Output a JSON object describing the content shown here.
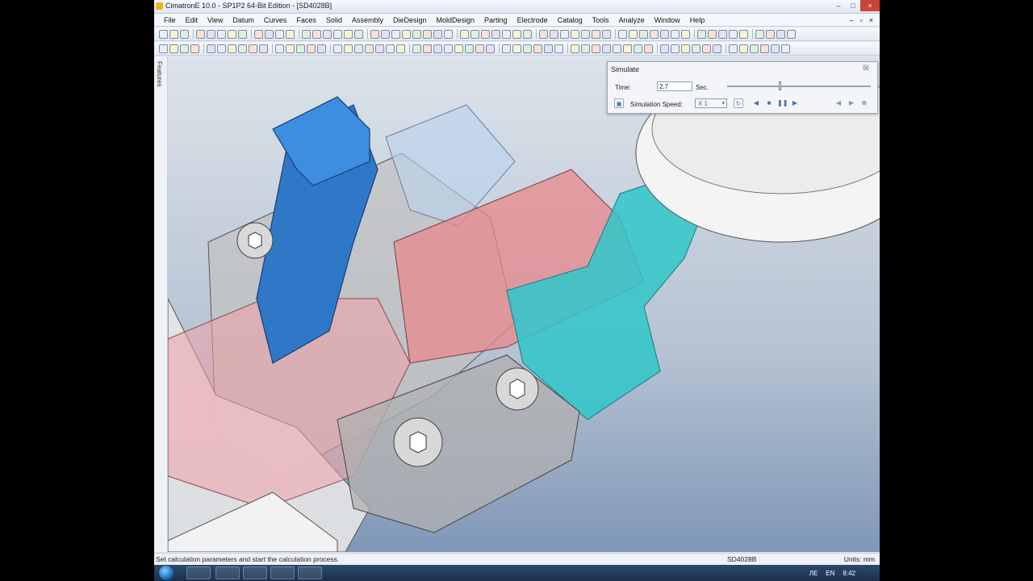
{
  "window": {
    "title": "CimatronE 10.0 - SP1P2 64-Bit Edition - [SD4028B]",
    "controls": [
      "–",
      "□",
      "×"
    ]
  },
  "menubar": {
    "items": [
      "File",
      "Edit",
      "View",
      "Datum",
      "Curves",
      "Faces",
      "Solid",
      "Assembly",
      "DieDesign",
      "MoldDesign",
      "Parting",
      "Electrode",
      "Catalog",
      "Tools",
      "Analyze",
      "Window",
      "Help"
    ],
    "doc_controls": [
      "–",
      "▫",
      "×"
    ]
  },
  "side_panel": {
    "label": "Features"
  },
  "simulate_dialog": {
    "title": "Simulate",
    "time_label": "Time:",
    "time_value": "2.7",
    "time_units": "Sec.",
    "speed_label": "Simulation Speed:",
    "speed_value": "X 1",
    "time_fraction": 0.36
  },
  "statusbar": {
    "message": "Set calculation parameters and start the calculation process.",
    "file": "SD4028B",
    "units": "Units: mm"
  },
  "taskbar": {
    "tray": {
      "lang": "ЛЕ",
      "kbd": "EN",
      "clock": "8:42"
    }
  },
  "colors": {
    "blue_part": "#2f78c8",
    "pink_part": "#e8888c",
    "cyan_part": "#2fc7c9",
    "gray_part": "#b8b8b8"
  }
}
